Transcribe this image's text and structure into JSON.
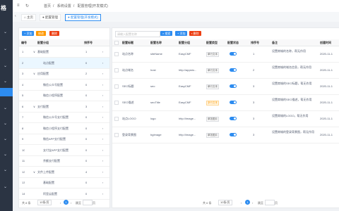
{
  "app": {
    "logo_text": "格"
  },
  "header": {
    "breadcrumbs": [
      "首页",
      "系统设置",
      "配置管理(开发模式)"
    ]
  },
  "tabs": [
    {
      "label": "主页"
    },
    {
      "label": "配置管理"
    },
    {
      "label": "配置管理(开发模式)"
    }
  ],
  "left_panel": {
    "buttons": {
      "add": "+ 添加",
      "edit": "修改",
      "delete": "删除"
    },
    "columns": {
      "id": "编号",
      "name": "配置分组",
      "sort": "排序号"
    },
    "rows": [
      {
        "id": "1",
        "name": "基础配置",
        "sort": "1"
      },
      {
        "id": "2",
        "name": "站点配置",
        "sort": "0"
      },
      {
        "id": "3",
        "name": "应用配置",
        "sort": "2"
      },
      {
        "id": "4",
        "name": "微信公众号配置",
        "sort": "0"
      },
      {
        "id": "5",
        "name": "微信小程序配置",
        "sort": "0"
      },
      {
        "id": "6",
        "name": "支付配置",
        "sort": "3"
      },
      {
        "id": "7",
        "name": "微信公众号支付配置",
        "sort": "0"
      },
      {
        "id": "8",
        "name": "微信小程序支付配置",
        "sort": "0"
      },
      {
        "id": "9",
        "name": "微信APP支付配置",
        "sort": "0"
      },
      {
        "id": "10",
        "name": "支付宝APP支付配置",
        "sort": "0"
      },
      {
        "id": "11",
        "name": "余额支付配置",
        "sort": "0"
      },
      {
        "id": "12",
        "name": "文件上传配置",
        "sort": "4"
      },
      {
        "id": "13",
        "name": "基础配置",
        "sort": "0"
      },
      {
        "id": "14",
        "name": "阿里云配置",
        "sort": "0"
      }
    ],
    "pager": {
      "total": "共 8 条",
      "size": "10条/页",
      "page": "1",
      "goto": "跳至",
      "unit": "页"
    }
  },
  "right_panel": {
    "search_placeholder": "请输入配置名称",
    "buttons": {
      "search": "搜索",
      "add": "+ 添加",
      "delete": "删除"
    },
    "columns": {
      "title": "配置标题",
      "key": "配置名称",
      "group": "配置分组",
      "type": "配置类型",
      "status": "配置状态",
      "sort": "排序号",
      "remark": "备注",
      "created": "创建时间"
    },
    "rows": [
      {
        "title": "站点名称",
        "key": "siteName",
        "group": "EasyCMF",
        "type": "单行文本",
        "sort": "1",
        "remark": "设置商城的名称，帮无作用",
        "created": "2020-11-1"
      },
      {
        "title": "站点域名",
        "key": "host",
        "group": "http://appsto...",
        "type": "单行文本",
        "sort": "2",
        "remark": "设置商城的域名信息，帮无作用",
        "created": "2020-11-1"
      },
      {
        "title": "SEO标题",
        "key": "seo",
        "group": "EasyCMF",
        "type": "单行文本",
        "sort": "3",
        "remark": "设置商城的SEO标题，帮无作用",
        "created": "2020-11-1"
      },
      {
        "title": "SEO描述",
        "key": "seoTitle",
        "group": "EasyCMF",
        "type": "多行文本",
        "sort": "3",
        "remark": "设置商城的SEO描述，帮无作用",
        "created": "2020-11-1"
      },
      {
        "title": "站点LOGO",
        "key": "logo",
        "group": "http://image...",
        "type": "单张图片",
        "sort": "3",
        "remark": "设置商城的LOGO，帮无作用",
        "created": "2020-11-1"
      },
      {
        "title": "登录背景图",
        "key": "bgImage",
        "group": "http://image...",
        "type": "单张图片",
        "sort": "3",
        "remark": "设置商城的登录背景图，帮无作用",
        "created": "2020-11-1"
      }
    ],
    "pager": {
      "total": "共 6 条",
      "size": "10条/页",
      "page": "1",
      "goto": "跳至",
      "unit": "页"
    }
  }
}
